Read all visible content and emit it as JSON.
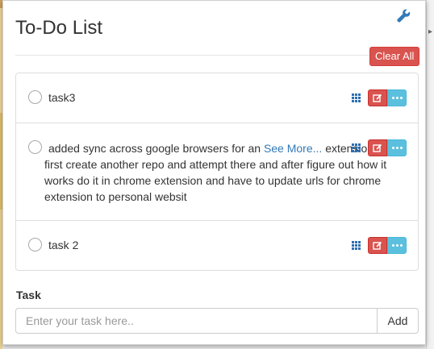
{
  "header": {
    "title": "To-Do List",
    "settings_icon": "wrench-icon"
  },
  "toolbar": {
    "clear_label": "Clear All"
  },
  "colors": {
    "danger": "#d9534f",
    "info": "#5bc0de",
    "link": "#337ab7"
  },
  "todos": [
    {
      "text": "task3",
      "see_more": ""
    },
    {
      "text": "added sync across google browsers for an ",
      "see_more": "See More...",
      "more_text": " extension.. but first create another repo and attempt there and after figure out how it works do it in chrome extension and have to update urls for chrome extension to personal websit"
    },
    {
      "text": "task 2",
      "see_more": ""
    }
  ],
  "form": {
    "label": "Task",
    "placeholder": "Enter your task here..",
    "value": "",
    "add_label": "Add"
  }
}
